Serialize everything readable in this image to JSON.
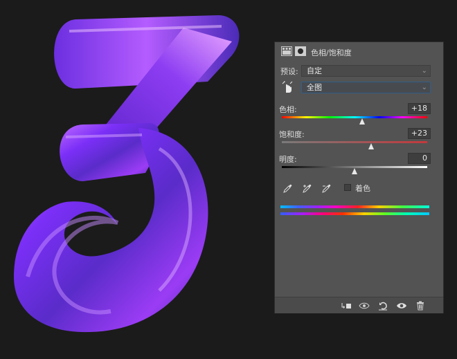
{
  "panel": {
    "title": "色相/饱和度",
    "preset_label": "预设:",
    "preset_value": "自定",
    "channel_value": "全图",
    "hue": {
      "label": "色相:",
      "value": "+18",
      "level": 0.55
    },
    "saturation": {
      "label": "饱和度:",
      "value": "+23",
      "level": 0.615
    },
    "lightness": {
      "label": "明度:",
      "value": "0",
      "level": 0.5
    },
    "colorize_label": "着色"
  },
  "colors": {
    "panel_bg": "#535353",
    "canvas_bg": "#1b1b1b",
    "accent": "#2f5e8a"
  },
  "icons": [
    "adjustment-layer-icon",
    "mask-icon",
    "hand-target-icon",
    "eyedropper-icon",
    "eyedropper-plus-icon",
    "eyedropper-minus-icon",
    "clip-to-layer-icon",
    "view-previous-state-icon",
    "reset-icon",
    "visibility-eye-icon",
    "trash-icon"
  ]
}
